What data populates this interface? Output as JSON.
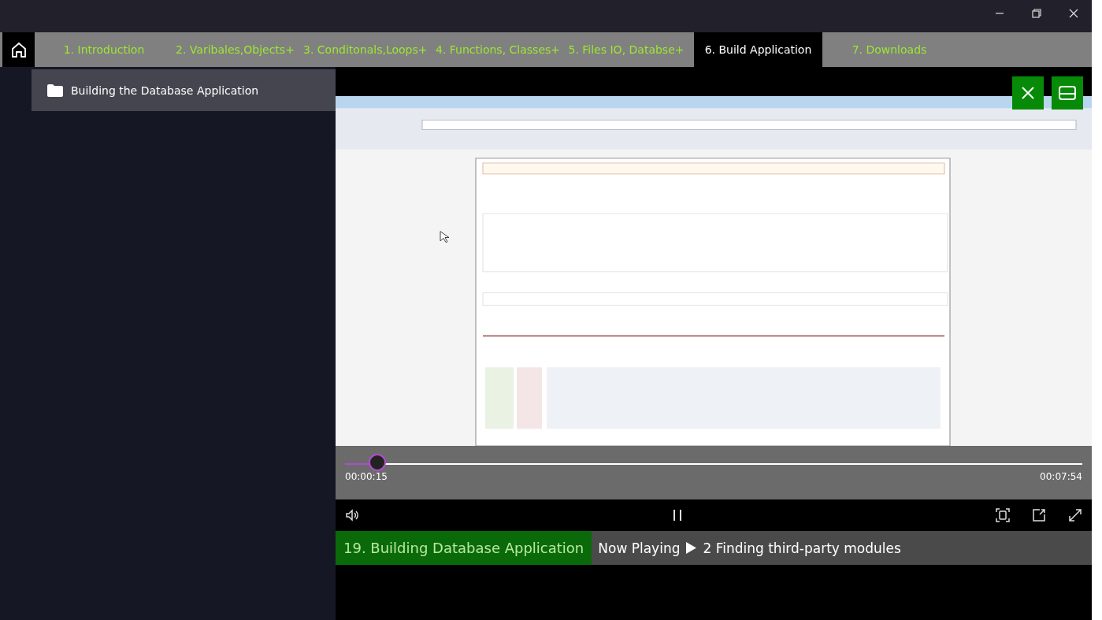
{
  "tabs": [
    {
      "label": "1. Introduction",
      "selected": false
    },
    {
      "label": "2. Varibales,Objects+",
      "selected": false
    },
    {
      "label": "3. Conditonals,Loops+",
      "selected": false
    },
    {
      "label": "4. Functions, Classes+",
      "selected": false
    },
    {
      "label": "5. Files IO, Databse+",
      "selected": false
    },
    {
      "label": "6. Build Application",
      "selected": true
    },
    {
      "label": "7. Downloads",
      "selected": false
    }
  ],
  "sidebar": {
    "items": [
      {
        "label": "Building the Database Application",
        "selected": true
      }
    ]
  },
  "player": {
    "progress": {
      "level": 0.044,
      "elapsed": "00:00:15",
      "duration": "00:07:54"
    }
  },
  "now_playing": {
    "chapter": "19. Building Database Application",
    "label": "Now Playing",
    "title": "2 Finding third-party modules"
  }
}
